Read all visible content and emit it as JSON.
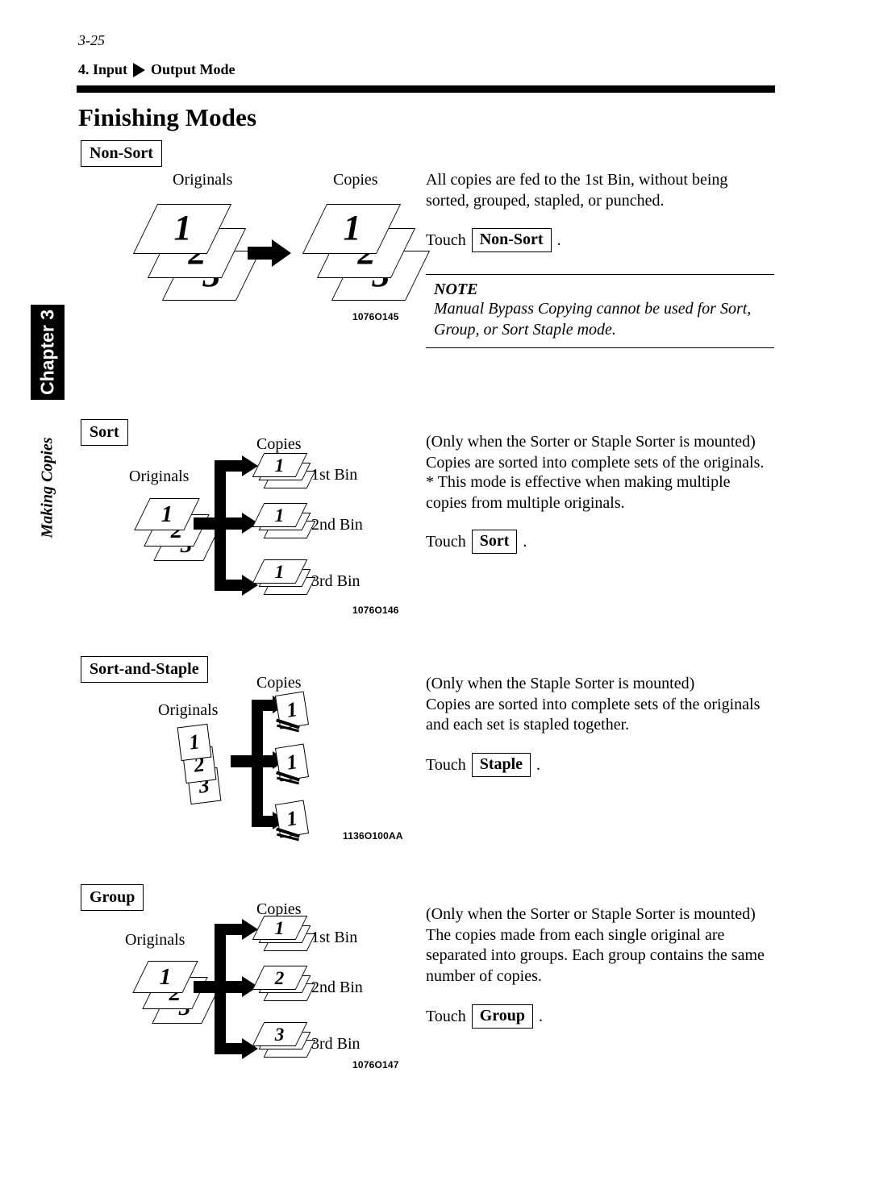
{
  "page": {
    "folio": "3-25",
    "running_head_prefix": "4. Input",
    "running_head_suffix": "Output Mode",
    "title": "Finishing Modes"
  },
  "side_tab": {
    "chapter": "Chapter 3",
    "part_title": "Making Copies"
  },
  "labels": {
    "originals": "Originals",
    "copies": "Copies",
    "bin1": "1st Bin",
    "bin2": "2nd Bin",
    "bin3": "3rd Bin",
    "touch": "Touch",
    "period": "."
  },
  "sections": [
    {
      "id": "non-sort",
      "tag": "Non-Sort",
      "body": "All copies are fed to the 1st Bin, without being\nsorted, grouped, stapled, or punched.",
      "key": "Non-Sort",
      "figure_code": "1076O145",
      "originals": [
        "1",
        "2",
        "3"
      ],
      "copies": [
        "1",
        "2",
        "3"
      ],
      "note": {
        "title": "NOTE",
        "text": "Manual Bypass Copying cannot be used for Sort,\nGroup, or Sort Staple mode."
      }
    },
    {
      "id": "sort",
      "tag": "Sort",
      "body": "(Only when the Sorter or Staple Sorter is mounted)\nCopies are sorted into complete sets of the originals.",
      "bullet": "*   This mode is effective when making multiple\n     copies from multiple originals.",
      "key": "Sort",
      "figure_code": "1076O146",
      "originals": [
        "1",
        "2",
        "3"
      ],
      "bins": [
        {
          "label": "1st Bin",
          "top": "1"
        },
        {
          "label": "2nd Bin",
          "top": "1"
        },
        {
          "label": "3rd Bin",
          "top": "1"
        }
      ]
    },
    {
      "id": "sort-and-staple",
      "tag": "Sort-and-Staple",
      "body": "(Only when the Staple Sorter is mounted)\nCopies are sorted into complete sets of the originals\nand each set is stapled together.",
      "key": "Staple",
      "figure_code": "1136O100AA",
      "originals": [
        "1",
        "2",
        "3"
      ],
      "sets": [
        "1",
        "1",
        "1"
      ]
    },
    {
      "id": "group",
      "tag": "Group",
      "body": "(Only when the Sorter or Staple Sorter is mounted)\nThe copies made from each single original are\nseparated into groups. Each group contains the same\nnumber of copies.",
      "key": "Group",
      "figure_code": "1076O147",
      "originals": [
        "1",
        "2",
        "3"
      ],
      "bins": [
        {
          "label": "1st Bin",
          "top": "1"
        },
        {
          "label": "2nd Bin",
          "top": "2"
        },
        {
          "label": "3rd Bin",
          "top": "3"
        }
      ]
    }
  ]
}
